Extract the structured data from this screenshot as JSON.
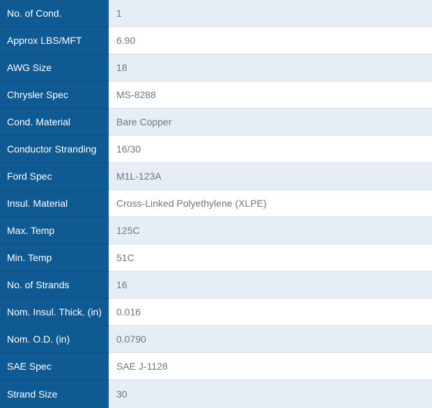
{
  "specs": {
    "rows": [
      {
        "label": "No. of Cond.",
        "value": "1"
      },
      {
        "label": "Approx LBS/MFT",
        "value": "6.90"
      },
      {
        "label": "AWG Size",
        "value": "18"
      },
      {
        "label": "Chrysler Spec",
        "value": "MS-8288"
      },
      {
        "label": "Cond. Material",
        "value": "Bare Copper"
      },
      {
        "label": "Conductor Stranding",
        "value": "16/30"
      },
      {
        "label": "Ford Spec",
        "value": "M1L-123A"
      },
      {
        "label": "Insul. Material",
        "value": "Cross-Linked Polyethylene (XLPE)"
      },
      {
        "label": "Max. Temp",
        "value": "125C"
      },
      {
        "label": "Min. Temp",
        "value": "51C"
      },
      {
        "label": "No. of Strands",
        "value": "16"
      },
      {
        "label": "Nom. Insul. Thick. (in)",
        "value": "0.016"
      },
      {
        "label": "Nom. O.D. (in)",
        "value": "0.0790"
      },
      {
        "label": "SAE Spec",
        "value": "SAE J-1128"
      },
      {
        "label": "Strand Size",
        "value": "30"
      }
    ]
  },
  "colors": {
    "label_background": "#0f5a92",
    "label_text": "#ffffff",
    "alternate_row_background": "#e6edf4",
    "value_text": "#6f7782"
  }
}
